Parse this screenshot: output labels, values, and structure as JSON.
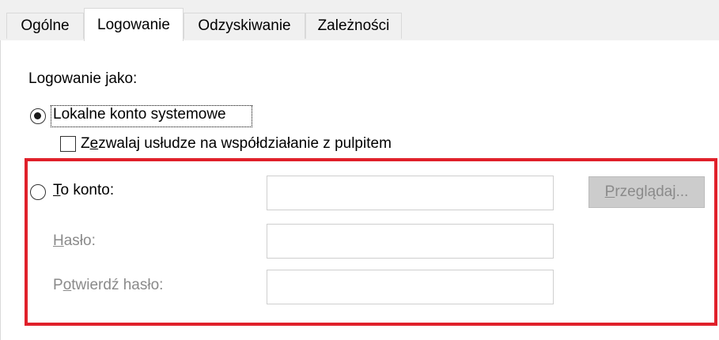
{
  "tabs": [
    {
      "label": "Ogólne"
    },
    {
      "label": "Logowanie"
    },
    {
      "label": "Odzyskiwanie"
    },
    {
      "label": "Zależności"
    }
  ],
  "logon": {
    "heading": "Logowanie jako:",
    "local_system": {
      "label": "Lokalne konto systemowe",
      "selected": true
    },
    "allow_desktop": {
      "label_before": "Z",
      "label_accel": "e",
      "label_after": "zwalaj usłudze na współdziałanie z pulpitem",
      "checked": false
    },
    "this_account": {
      "accel": "T",
      "label_rest": "o konto:",
      "selected": false,
      "value": ""
    },
    "browse_button": {
      "accel": "P",
      "label_rest": "rzeglądaj..."
    },
    "password": {
      "accel": "H",
      "label_rest": "asło:",
      "value": ""
    },
    "confirm_password": {
      "label_before": "P",
      "accel": "o",
      "label_rest": "twierdź hasło:",
      "value": ""
    }
  },
  "colors": {
    "highlight_border": "#e0202a",
    "disabled_text": "#8a8a8a"
  }
}
